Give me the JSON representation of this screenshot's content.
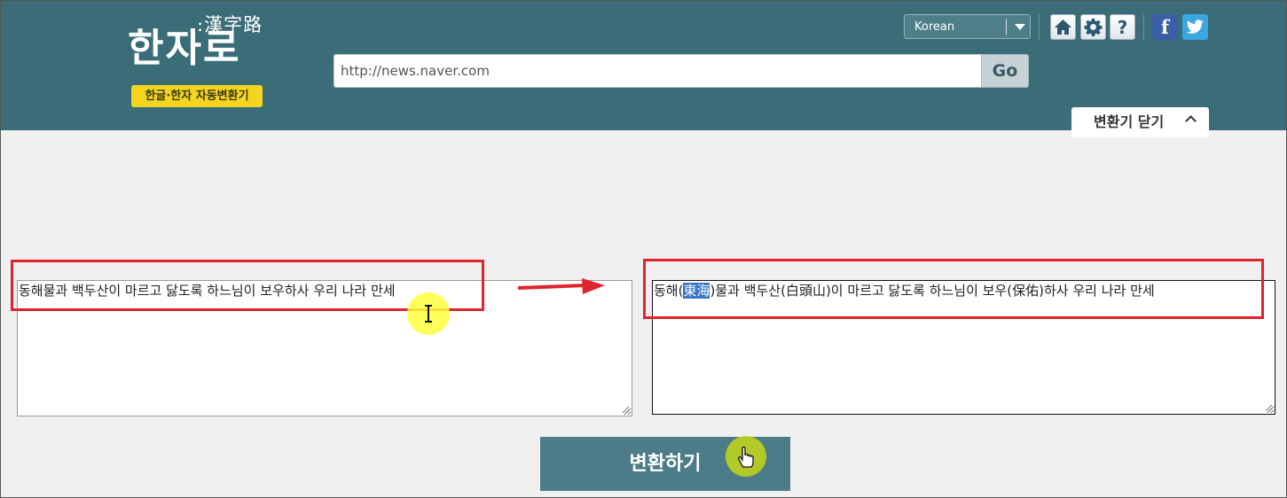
{
  "header": {
    "logo_hanja": ":漢字路",
    "logo_main": "한자로",
    "logo_badge": "한글·한자 자동변환기",
    "url_value": "http://news.naver.com",
    "go_label": "Go",
    "language": {
      "selected": "Korean"
    },
    "help_label": "?",
    "facebook_label": "f",
    "close_tab_label": "변환기 닫기"
  },
  "converter": {
    "input_text": "동해물과 백두산이 마르고 닳도록 하느님이 보우하사 우리 나라 만세",
    "output_parts": {
      "before": "동해(",
      "selected": "東海",
      "after": ")물과 백두산(白頭山)이 마르고 닳도록 하느님이 보우(保佑)하사 우리 나라 만세"
    },
    "convert_label": "변환하기"
  },
  "colors": {
    "header_bg": "#3a6d78",
    "badge_yellow": "#f4d41c",
    "annotation_red": "#e0242f",
    "convert_button": "#4c7c88"
  },
  "icons": [
    "home-icon",
    "gear-icon",
    "help-icon",
    "facebook-icon",
    "twitter-icon",
    "chevron-up-icon",
    "dropdown-arrow-icon"
  ]
}
